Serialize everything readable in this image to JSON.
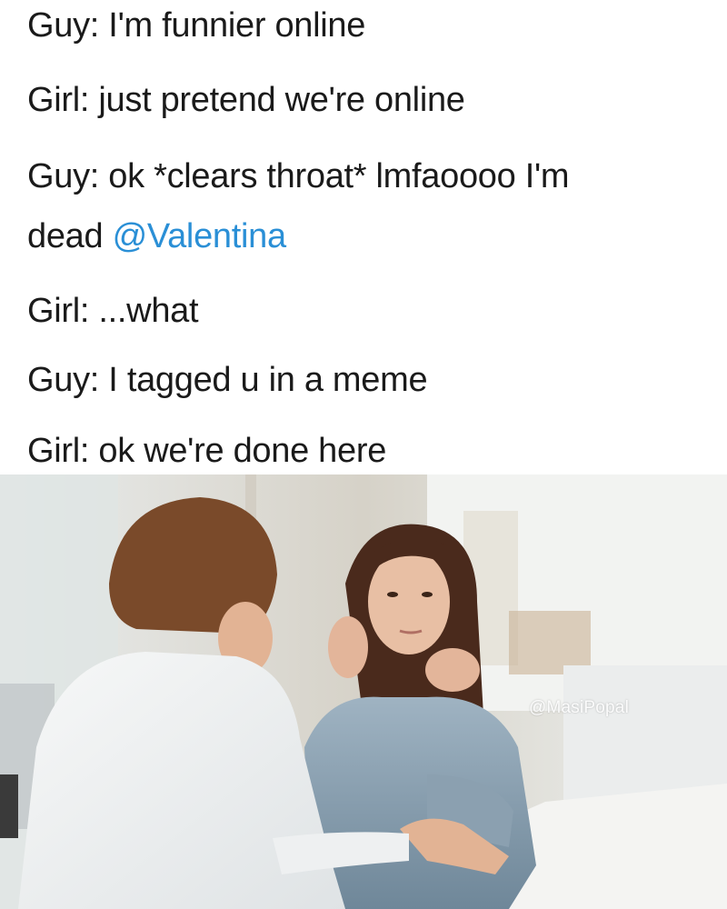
{
  "caption": {
    "lines": [
      {
        "text": "Guy: I'm funnier online"
      },
      {
        "text": "Girl: just pretend we're online"
      },
      {
        "text": "Guy: ok *clears throat* lmfaoooo I'm"
      },
      {
        "prefix": "dead ",
        "mention": "@Valentina"
      },
      {
        "text": "Girl: ...what"
      },
      {
        "text": "Guy: I tagged u in a meme"
      },
      {
        "text": "Girl: ok we're done here"
      }
    ],
    "mention_color": "#2a8fd6"
  },
  "photo": {
    "watermark": "@MasiPopal",
    "scene": "stock-photo-couple-at-cafe-table"
  }
}
